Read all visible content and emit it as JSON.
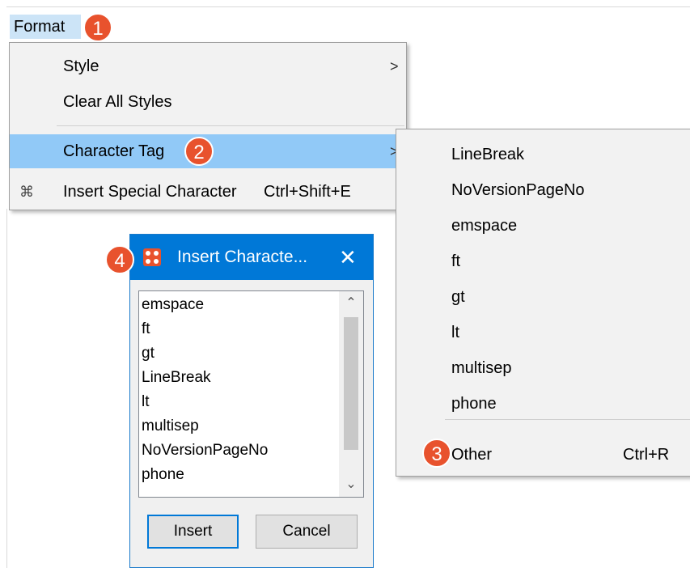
{
  "menubar": {
    "format_label": "Format"
  },
  "badges": {
    "b1": "1",
    "b2": "2",
    "b3": "3",
    "b4": "4"
  },
  "format_menu": {
    "style": "Style",
    "clear_all_styles": "Clear All Styles",
    "character_tag": "Character Tag",
    "insert_special_character": "Insert Special Character",
    "insert_special_shortcut": "Ctrl+Shift+E",
    "submenu_arrow": ">"
  },
  "character_tag_submenu": {
    "items": [
      "LineBreak",
      "NoVersionPageNo",
      "emspace",
      "ft",
      "gt",
      "lt",
      "multisep",
      "phone"
    ],
    "other_label": "Other",
    "other_shortcut": "Ctrl+R"
  },
  "dialog": {
    "title": "Insert Characte...",
    "close": "✕",
    "list_items": [
      "emspace",
      "ft",
      "gt",
      "LineBreak",
      "lt",
      "multisep",
      "NoVersionPageNo",
      "phone"
    ],
    "scroll_up": "⌃",
    "scroll_down": "⌄",
    "insert_label": "Insert",
    "cancel_label": "Cancel"
  },
  "colors": {
    "accent": "#0078d7",
    "badge": "#e8522d",
    "highlight": "#91c9f7",
    "menubar_active": "#cce4f7"
  }
}
